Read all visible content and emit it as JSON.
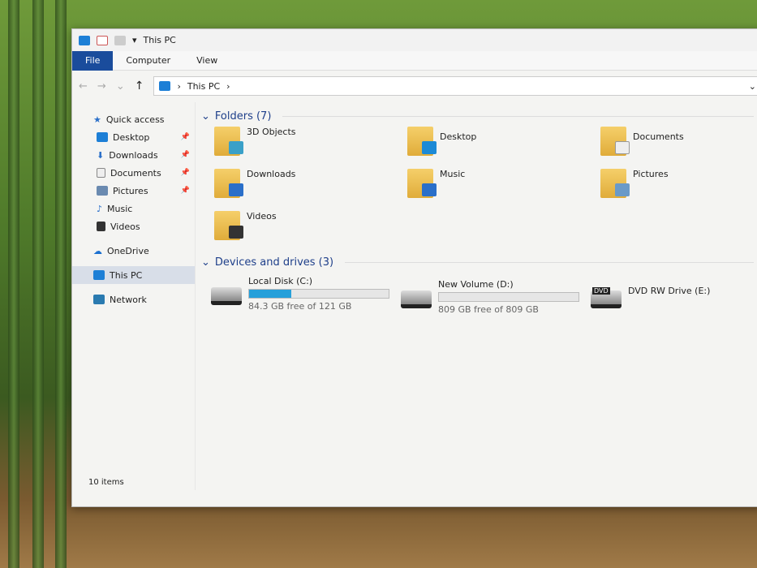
{
  "window": {
    "title": "This PC"
  },
  "ribbon": {
    "tabs": [
      "File",
      "Computer",
      "View"
    ]
  },
  "address": {
    "crumbs": [
      "This PC"
    ]
  },
  "sidebar": {
    "items": [
      {
        "label": "Quick access",
        "icon": "star-icon",
        "color": "#2a6fc9",
        "pinned": false
      },
      {
        "label": "Desktop",
        "icon": "desktop-icon",
        "color": "#1d7fd6",
        "pinned": true
      },
      {
        "label": "Downloads",
        "icon": "download-icon",
        "color": "#2a6fc9",
        "pinned": true
      },
      {
        "label": "Documents",
        "icon": "document-icon",
        "color": "#8a8a8a",
        "pinned": true
      },
      {
        "label": "Pictures",
        "icon": "pictures-icon",
        "color": "#6a8ab0",
        "pinned": true
      },
      {
        "label": "Music",
        "icon": "music-icon",
        "color": "#2a6fc9",
        "pinned": false
      },
      {
        "label": "Videos",
        "icon": "videos-icon",
        "color": "#333333",
        "pinned": false
      },
      {
        "label": "OneDrive",
        "icon": "cloud-icon",
        "color": "#1a6fd0",
        "pinned": false
      },
      {
        "label": "This PC",
        "icon": "computer-icon",
        "color": "#1d7fd6",
        "pinned": false,
        "selected": true
      },
      {
        "label": "Network",
        "icon": "network-icon",
        "color": "#2a7ab0",
        "pinned": false
      }
    ]
  },
  "folders": {
    "header": "Folders (7)",
    "items": [
      {
        "label": "3D Objects",
        "color": "#3aa0c8"
      },
      {
        "label": "Desktop",
        "color": "#1d8ad6"
      },
      {
        "label": "Documents",
        "color": "#e8e8e8"
      },
      {
        "label": "Downloads",
        "color": "#2a6fc9"
      },
      {
        "label": "Music",
        "color": "#2a6fc9"
      },
      {
        "label": "Pictures",
        "color": "#6a9ac8"
      },
      {
        "label": "Videos",
        "color": "#333333"
      }
    ]
  },
  "drives": {
    "header": "Devices and drives (3)",
    "items": [
      {
        "label": "Local Disk (C:)",
        "free": "84.3 GB free of 121 GB",
        "used_fraction": 0.3
      },
      {
        "label": "New Volume (D:)",
        "free": "809 GB free of 809 GB",
        "used_fraction": 0.0
      },
      {
        "label": "DVD RW Drive (E:)",
        "badge": "DVD"
      }
    ]
  },
  "status": {
    "items": "10 items"
  }
}
